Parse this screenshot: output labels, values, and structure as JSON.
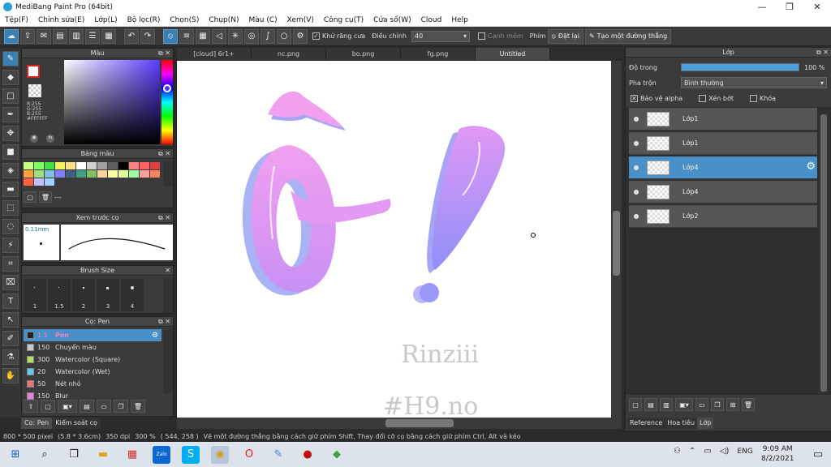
{
  "window": {
    "title": "MediBang Paint Pro (64bit)",
    "minimize": "—",
    "maximize": "❐",
    "close": "✕"
  },
  "menu": [
    "Tệp(F)",
    "Chỉnh sửa(E)",
    "Lớp(L)",
    "Bộ lọc(R)",
    "Chọn(S)",
    "Chụp(N)",
    "Màu (C)",
    "Xem(V)",
    "Công cụ(T)",
    "Cửa số(W)",
    "Cloud",
    "Help"
  ],
  "toolbar": {
    "antialias_label": "Khử răng cưa",
    "correction_label": "Điều chỉnh",
    "correction_value": "40",
    "edge_label": "Cạnh mềm",
    "key_label": "Phím",
    "reset_label": "Đặt lại",
    "straight_label": "Tạo một đường thẳng"
  },
  "color_panel": {
    "title": "Màu",
    "r": "R:255",
    "g": "G:255",
    "b": "B:255",
    "hex": "#FFFFFF"
  },
  "palette_panel": {
    "title": "Bảng màu",
    "more": "---",
    "swatches": [
      "#c8ff80",
      "#80ff60",
      "#40e040",
      "#f0f060",
      "#ffe080",
      "#ffffff",
      "#d0d0d0",
      "#a0a0a0",
      "#606060",
      "#000000",
      "#ff8080",
      "#ff6060",
      "#e04040",
      "#ffa040",
      "#a0e080",
      "#80c0e0",
      "#8080ff",
      "#406080",
      "#40a080",
      "#80c060",
      "#ffd0a0",
      "#ffffa0",
      "#e0ffa0",
      "#a0ffa0",
      "#ffa0a0",
      "#ff8060",
      "#ff6040",
      "#c0c0ff",
      "#a0d0ff"
    ]
  },
  "brush_preview": {
    "title": "Xem trước cọ",
    "size": "0.11mm"
  },
  "brush_size": {
    "title": "Brush Size",
    "sizes": [
      "1",
      "1.5",
      "2",
      "3",
      "4"
    ]
  },
  "brush_panel": {
    "title": "Cọ: Pen",
    "items": [
      {
        "size": "1.5",
        "name": "Pen",
        "color": "#222222"
      },
      {
        "size": "150",
        "name": "Chuyển màu",
        "color": "#c8c8c8"
      },
      {
        "size": "300",
        "name": "Watercolor (Square)",
        "color": "#b0e060"
      },
      {
        "size": "20",
        "name": "Watercolor (Wet)",
        "color": "#60c8f0"
      },
      {
        "size": "50",
        "name": "Nét nhỏ",
        "color": "#f07070"
      },
      {
        "size": "150",
        "name": "Blur",
        "color": "#e080e0"
      }
    ]
  },
  "bottom_left_tabs": [
    "Cọ: Pen",
    "Kiểm soát cọ"
  ],
  "canvas_tabs": [
    "[cloud] 6r1+",
    "nc.png",
    "bo.png",
    "fg.png",
    "Untitled"
  ],
  "canvas_text": {
    "line1": "Rinziii",
    "line2": "#H9.no"
  },
  "layer_panel": {
    "title": "Lớp",
    "opacity_label": "Độ trong",
    "opacity_value": "100 %",
    "opacity_fraction": 1.0,
    "blend_label": "Pha trộn",
    "blend_value": "Bình thường",
    "protect_alpha": "Bảo vệ alpha",
    "clipping": "Xén bớt",
    "lock": "Khóa",
    "layers": [
      "Lớp1",
      "Lớp1",
      "Lớp4",
      "Lớp4",
      "Lớp2"
    ],
    "selected_index": 2
  },
  "right_tabs": [
    "Reference",
    "Hoa tiêu",
    "Lớp"
  ],
  "status": {
    "size": "800 * 500 pixel",
    "cm": "(5.8 * 3.6cm)",
    "dpi": "350 dpi",
    "zoom": "300 %",
    "coords": "( 544, 258 )",
    "hint": "Vẽ một đường thẳng bằng cách giữ phím Shift, Thay đổi cỡ cọ bằng cách giữ phím Ctrl, Alt và kéo"
  },
  "taskbar": {
    "lang": "ENG",
    "time": "9:09 AM",
    "date": "8/2/2021"
  }
}
